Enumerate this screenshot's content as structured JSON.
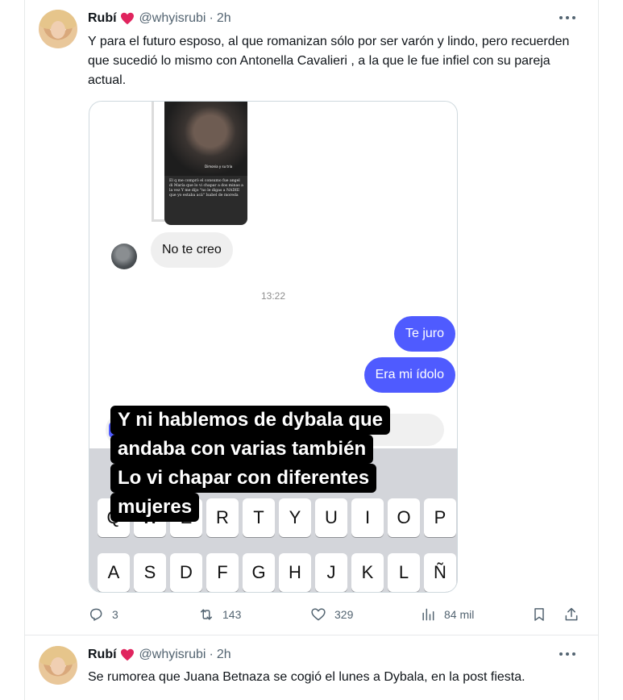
{
  "tweets": [
    {
      "author": {
        "name": "Rubí",
        "handle": "@whyisrubi",
        "time": "2h"
      },
      "text": "Y para el futuro esposo, al que romanizan sólo por ser varón y lindo, pero recuerden que sucedió lo mismo con Antonella Cavalieri , a la que le fue infiel con su pareja actual.",
      "media": {
        "story_tag": "Dimonia y su tria",
        "story_caption": "El q me comprò el consumo fue angel di María que lo vi chapar a dos minas a la vez Y me dijo \"no le digas a NADIE que yo estaba acá\" Isabel de moreda",
        "messages": {
          "received": "No te creo",
          "timestamp": "13:22",
          "sent": [
            "Te juro",
            "Era mi ídolo"
          ]
        },
        "overlay_lines": [
          "Y ni hablemos de dybala que",
          "andaba con varias también",
          "Lo vi chapar con diferentes",
          "mujeres"
        ],
        "keyboard": {
          "row1": [
            "Q",
            "W",
            "E",
            "R",
            "T",
            "Y",
            "U",
            "I",
            "O",
            "P"
          ],
          "row2": [
            "A",
            "S",
            "D",
            "F",
            "G",
            "H",
            "J",
            "K",
            "L",
            "Ñ"
          ]
        }
      },
      "actions": {
        "replies": "3",
        "retweets": "143",
        "likes": "329",
        "views": "84 mil"
      }
    },
    {
      "author": {
        "name": "Rubí",
        "handle": "@whyisrubi",
        "time": "2h"
      },
      "text": "Se rumorea que Juana Betnaza se cogió el lunes a Dybala, en la post fiesta."
    }
  ],
  "icons": {
    "heart": "red-heart-icon",
    "more": "more-icon",
    "reply": "reply-icon",
    "retweet": "retweet-icon",
    "like": "like-icon",
    "views": "views-icon",
    "bookmark": "bookmark-icon",
    "share": "share-icon"
  },
  "colors": {
    "accent_heart": "#e0245e",
    "message_blue": "#4f5bff",
    "meta_gray": "#536471"
  },
  "separator": "·"
}
